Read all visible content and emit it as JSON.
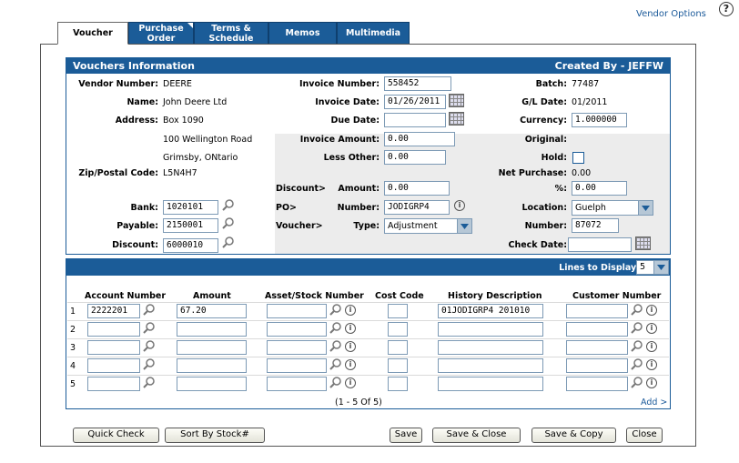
{
  "header": {
    "vendor_options": "Vendor Options",
    "help": "?"
  },
  "tabs": [
    {
      "label": "Voucher"
    },
    {
      "label": "Purchase Order"
    },
    {
      "label": "Terms & Schedule"
    },
    {
      "label": "Memos"
    },
    {
      "label": "Multimedia"
    }
  ],
  "info": {
    "title": "Vouchers Information",
    "created_by": "Created By  -  JEFFW",
    "vendor_number_label": "Vendor Number:",
    "vendor_number": "DEERE",
    "name_label": "Name:",
    "name": "John Deere Ltd",
    "address_label": "Address:",
    "address1": "Box 1090",
    "address2": "100 Wellington Road",
    "address3": "Grimsby, ONtario",
    "zip_label": "Zip/Postal Code:",
    "zip": "L5N4H7",
    "bank_label": "Bank:",
    "bank": "1020101",
    "payable_label": "Payable:",
    "payable": "2150001",
    "discount_acct_label": "Discount:",
    "discount_acct": "6000010",
    "invoice_number_label": "Invoice Number:",
    "invoice_number": "558452",
    "invoice_date_label": "Invoice Date:",
    "invoice_date": "01/26/2011",
    "due_date_label": "Due Date:",
    "due_date": "",
    "invoice_amount_label": "Invoice Amount:",
    "invoice_amount": "0.00",
    "less_other_label": "Less Other:",
    "less_other": "0.00",
    "discount_section": "Discount>",
    "amount_label": "Amount:",
    "discount_amount": "0.00",
    "po_section": "PO>",
    "po_number_label": "Number:",
    "po_number": "JODIGRP4",
    "voucher_section": "Voucher>",
    "type_label": "Type:",
    "type": "Adjustment",
    "batch_label": "Batch:",
    "batch": "77487",
    "gl_date_label": "G/L Date:",
    "gl_date": "01/2011",
    "currency_label": "Currency:",
    "currency": "1.000000",
    "original_label": "Original:",
    "hold_label": "Hold:",
    "net_purchase_label": "Net Purchase:",
    "net_purchase": "0.00",
    "percent_label": "%:",
    "percent": "0.00",
    "location_label": "Location:",
    "location": "Guelph",
    "voucher_number_label": "Number:",
    "voucher_number": "87072",
    "check_date_label": "Check Date:",
    "check_date": ""
  },
  "lines": {
    "display_label": "Lines to Display:",
    "display_value": "5",
    "columns": [
      "Account Number",
      "Amount",
      "Asset/Stock Number",
      "Cost Code",
      "History Description",
      "Customer Number"
    ],
    "rows": [
      {
        "num": "1",
        "account": "2222201",
        "amount": "67.20",
        "asset": "",
        "cost": "",
        "history": "01JODIGRP4 201010",
        "customer": ""
      },
      {
        "num": "2",
        "account": "",
        "amount": "",
        "asset": "",
        "cost": "",
        "history": "",
        "customer": ""
      },
      {
        "num": "3",
        "account": "",
        "amount": "",
        "asset": "",
        "cost": "",
        "history": "",
        "customer": ""
      },
      {
        "num": "4",
        "account": "",
        "amount": "",
        "asset": "",
        "cost": "",
        "history": "",
        "customer": ""
      },
      {
        "num": "5",
        "account": "",
        "amount": "",
        "asset": "",
        "cost": "",
        "history": "",
        "customer": ""
      }
    ],
    "pagination": "(1  -  5  Of  5)",
    "add": "Add >"
  },
  "buttons": {
    "quick_check": "Quick Check",
    "sort_by_stock": "Sort By Stock#",
    "save": "Save",
    "save_close": "Save & Close",
    "save_copy": "Save & Copy",
    "close": "Close"
  }
}
